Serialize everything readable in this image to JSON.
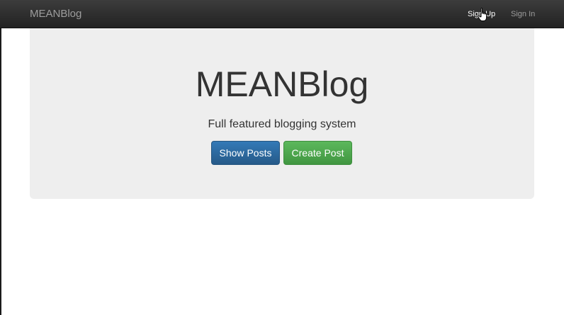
{
  "navbar": {
    "brand": "MEANBlog",
    "links": [
      {
        "label": "Sign Up",
        "active": true
      },
      {
        "label": "Sign In",
        "active": false
      }
    ]
  },
  "jumbotron": {
    "title": "MEANBlog",
    "subtitle": "Full featured blogging system",
    "buttons": {
      "show_posts": "Show Posts",
      "create_post": "Create Post"
    }
  },
  "colors": {
    "navbar_bg": "#222222",
    "jumbotron_bg": "#eeeeee",
    "primary": "#337ab7",
    "success": "#5cb85c"
  },
  "icons": {
    "cursor": "hand-pointer-icon"
  }
}
